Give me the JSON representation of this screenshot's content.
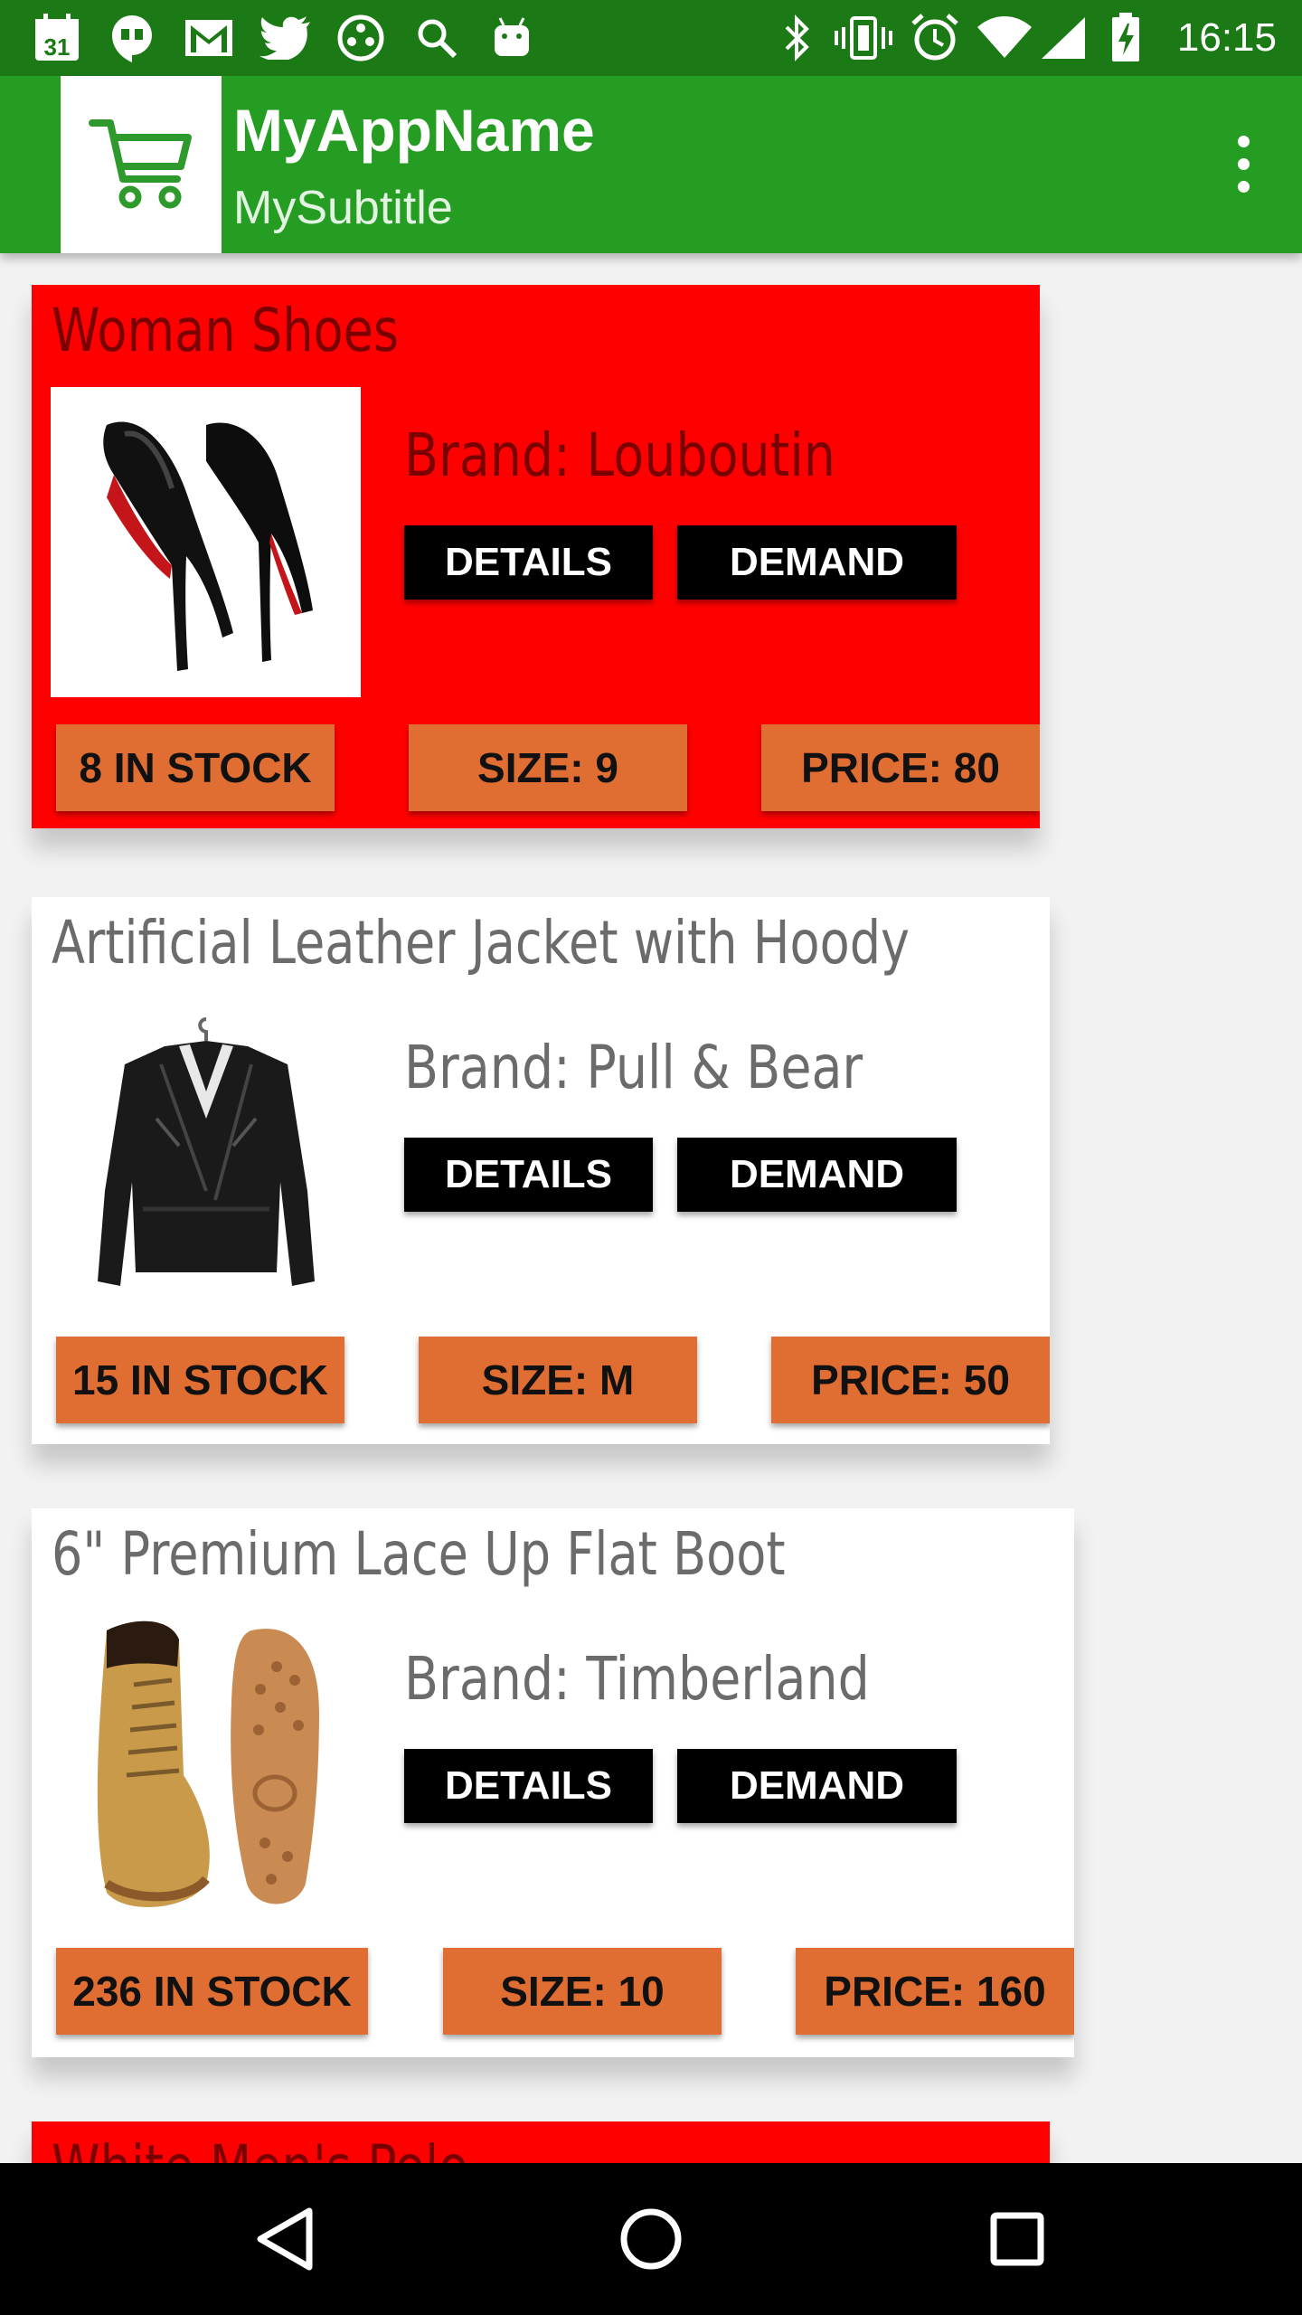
{
  "status_bar": {
    "time": "16:15",
    "calendar_day": "31",
    "colors": {
      "background": "#1c7a16"
    },
    "icons": [
      "calendar-icon",
      "hangouts-icon",
      "gmail-icon",
      "twitter-icon",
      "game-icon",
      "search-icon",
      "android-icon",
      "bluetooth-icon",
      "vibrate-icon",
      "alarm-icon",
      "wifi-icon",
      "signal-icon",
      "battery-charging-icon"
    ]
  },
  "app_bar": {
    "title": "MyAppName",
    "subtitle": "MySubtitle",
    "logo_icon": "shopping-cart-icon",
    "menu_icon": "overflow-menu-icon",
    "colors": {
      "background": "#259d22",
      "logo_stroke": "#2e9a2b"
    }
  },
  "products": [
    {
      "title": "Woman Shoes",
      "brand_text": "Brand: Louboutin",
      "details_label": "DETAILS",
      "demand_label": "DEMAND",
      "stock_label": "8 IN STOCK",
      "size_label": "SIZE: 9",
      "price_label": "PRICE: 80",
      "image_icon": "heels-image",
      "card_color": "#ff0000"
    },
    {
      "title": "Artificial Leather Jacket with Hoody",
      "brand_text": "Brand: Pull & Bear",
      "details_label": "DETAILS",
      "demand_label": "DEMAND",
      "stock_label": "15 IN STOCK",
      "size_label": "SIZE: M",
      "price_label": "PRICE: 50",
      "image_icon": "jacket-image",
      "card_color": "#ffffff"
    },
    {
      "title": "6\" Premium Lace Up Flat Boot",
      "brand_text": "Brand: Timberland",
      "details_label": "DETAILS",
      "demand_label": "DEMAND",
      "stock_label": "236 IN STOCK",
      "size_label": "SIZE: 10",
      "price_label": "PRICE: 160",
      "image_icon": "boots-image",
      "card_color": "#ffffff"
    },
    {
      "title": "White Men's Polo",
      "card_color": "#ff0000"
    }
  ],
  "colors": {
    "chip": "#e06d32",
    "button": "#000000",
    "page_background": "#f2f2f2"
  },
  "nav_bar": {
    "icons": [
      "back-icon",
      "home-icon",
      "recents-icon"
    ]
  }
}
